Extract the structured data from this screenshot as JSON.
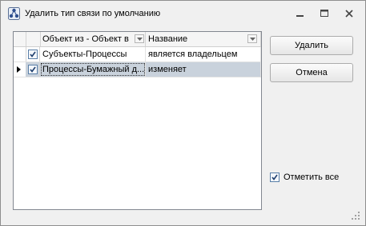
{
  "window": {
    "title": "Удалить тип связи по умолчанию",
    "icon": "network-nodes-icon"
  },
  "grid": {
    "columns": [
      {
        "label": "Объект из - Объект в"
      },
      {
        "label": "Название"
      }
    ],
    "rows": [
      {
        "checked": true,
        "pair": "Субъекты-Процессы",
        "name": "является владельцем",
        "selected": false
      },
      {
        "checked": true,
        "pair": "Процессы-Бумажный д...",
        "name": "изменяет",
        "selected": true
      }
    ],
    "selected_row_color": "#c9d2dc"
  },
  "buttons": {
    "delete_label": "Удалить",
    "cancel_label": "Отмена"
  },
  "check_all": {
    "label": "Отметить все",
    "checked": true
  },
  "colors": {
    "window_bg": "#f0f0f0",
    "checkbox_border": "#5a7fa8"
  }
}
